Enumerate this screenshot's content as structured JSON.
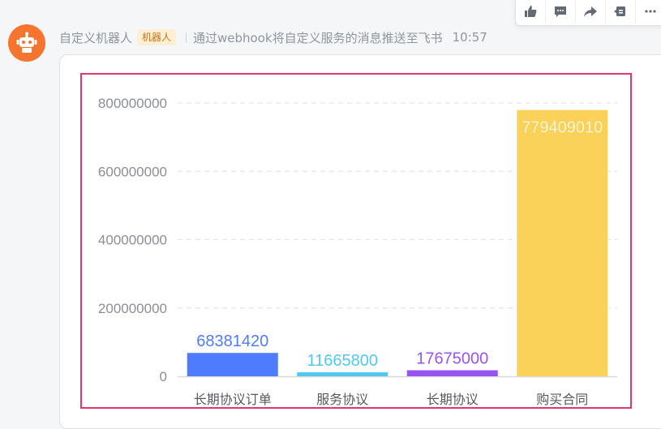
{
  "toolbar": {
    "icons": [
      "thumbs-up-icon",
      "comment-icon",
      "forward-icon",
      "pin-icon",
      "more-icon"
    ]
  },
  "message": {
    "sender": "自定义机器人",
    "badge": "机器人",
    "description": "通过webhook将自定义服务的消息推送至飞书",
    "time": "10:57",
    "avatar_color": "#f5752f"
  },
  "chart_data": {
    "type": "bar",
    "categories": [
      "长期协议订单",
      "服务协议",
      "长期协议",
      "购买合同"
    ],
    "values": [
      68381420,
      11665800,
      17675000,
      779409010
    ],
    "colors": [
      "#4f7cff",
      "#4fc9f0",
      "#9754f0",
      "#fad25a"
    ],
    "data_labels": [
      "68381420",
      "11665800",
      "17675000",
      "779409010"
    ],
    "yticks": [
      "0",
      "200000000",
      "400000000",
      "600000000",
      "800000000"
    ],
    "ylim": [
      0,
      800000000
    ],
    "grid": true,
    "frame_color": "#e0376b"
  }
}
